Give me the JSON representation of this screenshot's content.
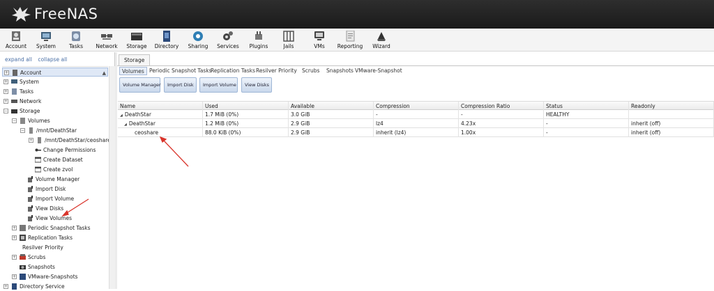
{
  "app": {
    "name": "FreeNAS"
  },
  "toolbar": [
    {
      "label": "Account",
      "icon": "account-icon"
    },
    {
      "label": "System",
      "icon": "system-icon"
    },
    {
      "label": "Tasks",
      "icon": "tasks-icon"
    },
    {
      "label": "Network",
      "icon": "network-icon"
    },
    {
      "label": "Storage",
      "icon": "storage-icon"
    },
    {
      "label": "Directory",
      "icon": "directory-icon"
    },
    {
      "label": "Sharing",
      "icon": "sharing-icon"
    },
    {
      "label": "Services",
      "icon": "services-icon"
    },
    {
      "label": "Plugins",
      "icon": "plugins-icon"
    },
    {
      "label": "Jails",
      "icon": "jails-icon"
    },
    {
      "label": "VMs",
      "icon": "vms-icon"
    },
    {
      "label": "Reporting",
      "icon": "reporting-icon"
    },
    {
      "label": "Wizard",
      "icon": "wizard-icon"
    }
  ],
  "sidebar": {
    "expand_all": "expand all",
    "collapse_all": "collapse all",
    "items": [
      {
        "label": "Account"
      },
      {
        "label": "System"
      },
      {
        "label": "Tasks"
      },
      {
        "label": "Network"
      },
      {
        "label": "Storage"
      },
      {
        "label": "Volumes"
      },
      {
        "label": "/mnt/DeathStar"
      },
      {
        "label": "/mnt/DeathStar/ceoshare"
      },
      {
        "label": "Change Permissions"
      },
      {
        "label": "Create Dataset"
      },
      {
        "label": "Create zvol"
      },
      {
        "label": "Volume Manager"
      },
      {
        "label": "Import Disk"
      },
      {
        "label": "Import Volume"
      },
      {
        "label": "View Disks"
      },
      {
        "label": "View Volumes"
      },
      {
        "label": "Periodic Snapshot Tasks"
      },
      {
        "label": "Replication Tasks"
      },
      {
        "label": "Resilver Priority"
      },
      {
        "label": "Scrubs"
      },
      {
        "label": "Snapshots"
      },
      {
        "label": "VMware-Snapshots"
      },
      {
        "label": "Directory Service"
      }
    ]
  },
  "main": {
    "tab": "Storage",
    "subtabs": [
      "Volumes",
      "Periodic Snapshot Tasks",
      "Replication Tasks",
      "Resilver Priority",
      "Scrubs",
      "Snapshots",
      "VMware-Snapshot"
    ],
    "buttons": [
      "Volume Manager",
      "Import Disk",
      "Import Volume",
      "View Disks"
    ],
    "columns": [
      "Name",
      "Used",
      "Available",
      "Compression",
      "Compression Ratio",
      "Status",
      "Readonly"
    ],
    "rows": [
      [
        "DeathStar",
        "1.7 MiB (0%)",
        "3.0 GiB",
        "-",
        "-",
        "HEALTHY",
        ""
      ],
      [
        "DeathStar",
        "1.2 MiB (0%)",
        "2.9 GiB",
        "lz4",
        "4.23x",
        "-",
        "inherit (off)"
      ],
      [
        "ceoshare",
        "88.0 KiB (0%)",
        "2.9 GiB",
        "inherit (lz4)",
        "1.00x",
        "-",
        "inherit (off)"
      ]
    ]
  },
  "colors": {
    "header_bg": "#1f1f1f",
    "annotation_arrow": "#d9342b",
    "selection_bg": "#dfe8f6"
  }
}
